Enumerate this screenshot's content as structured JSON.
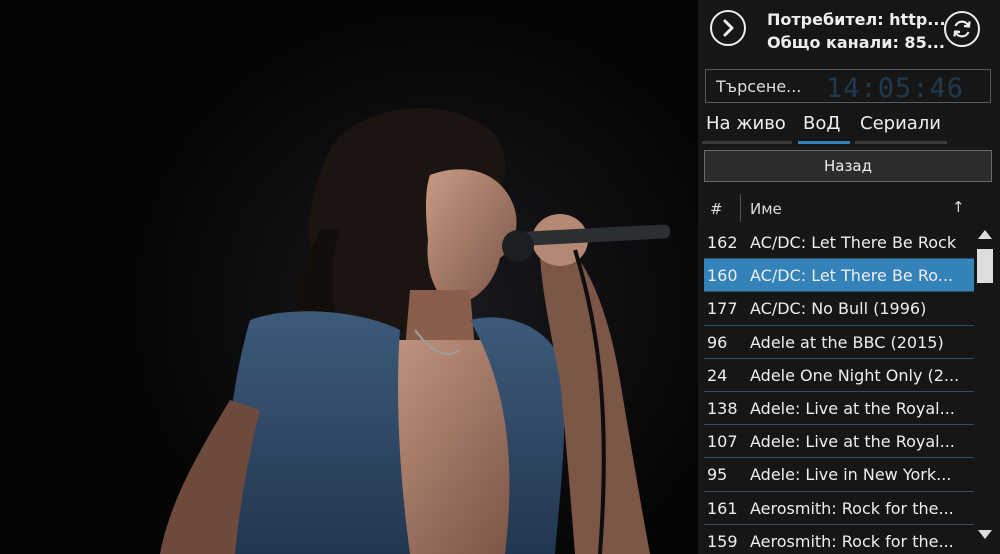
{
  "player": {
    "content": "concert-video-frame"
  },
  "header": {
    "user_line": "Потребител: http...",
    "channels_line": "Общо канали: 85..."
  },
  "search": {
    "placeholder": "Търсене...",
    "value": "",
    "background_clock": "14:05:46"
  },
  "tabs": [
    {
      "label": "На живо"
    },
    {
      "label": "ВоД",
      "active": true
    },
    {
      "label": "Сериали"
    }
  ],
  "back_label": "Назад",
  "table": {
    "columns": {
      "number": "#",
      "name": "Име",
      "sort_icon": "↑"
    },
    "rows": [
      {
        "num": "162",
        "name": "AC/DC: Let There Be Rock"
      },
      {
        "num": "160",
        "name": "AC/DC: Let There Be Ro...",
        "selected": true
      },
      {
        "num": "177",
        "name": "AC/DC: No Bull (1996)"
      },
      {
        "num": "96",
        "name": "Adele at the BBC  (2015)"
      },
      {
        "num": "24",
        "name": "Adele One Night Only (2..."
      },
      {
        "num": "138",
        "name": "Adele: Live at the Royal..."
      },
      {
        "num": "107",
        "name": "Adele: Live at the Royal..."
      },
      {
        "num": "95",
        "name": "Adele: Live in New York..."
      },
      {
        "num": "161",
        "name": "Aerosmith: Rock for the..."
      },
      {
        "num": "159",
        "name": "Aerosmith: Rock for the..."
      }
    ]
  },
  "colors": {
    "panel_bg": "#161616",
    "accent": "#3382ba",
    "row_divider": "#2d4f6b",
    "text": "#eeeeee"
  },
  "icons": {
    "play": "chevron-right-circle-icon",
    "refresh": "refresh-icon",
    "sort": "arrow-up-icon"
  }
}
